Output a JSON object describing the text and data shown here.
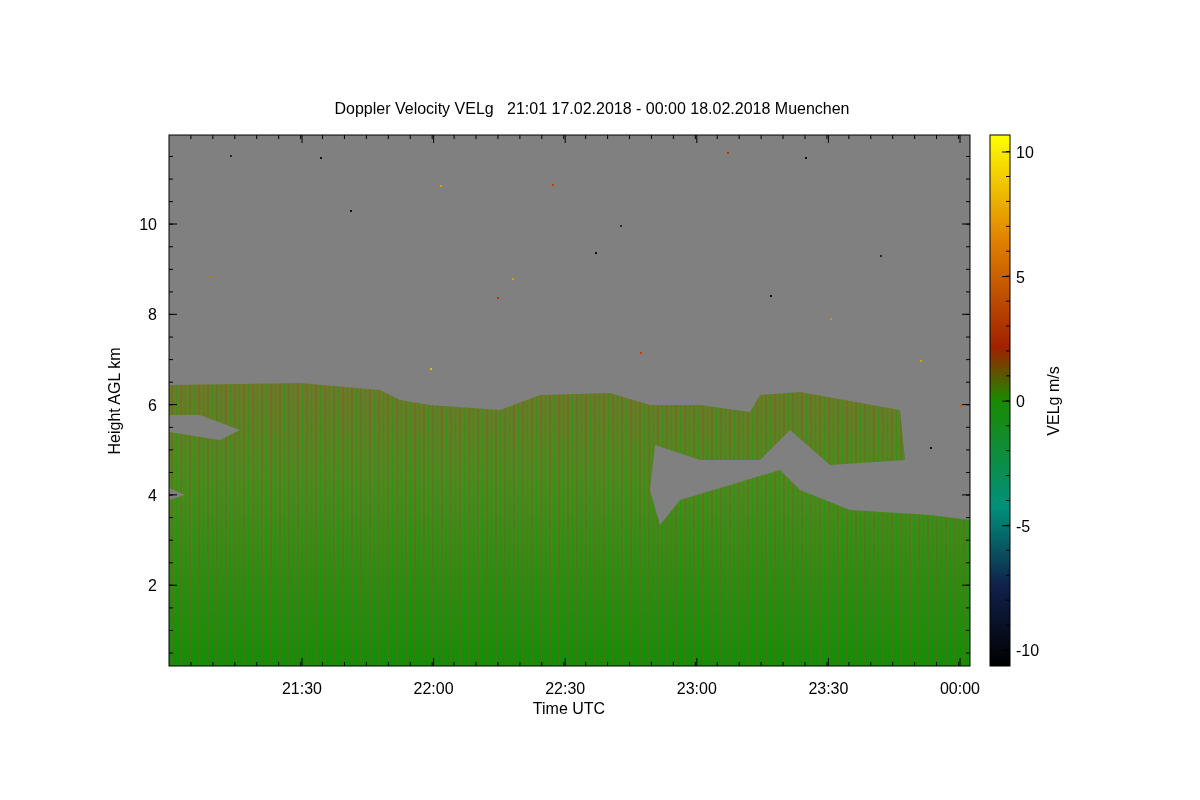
{
  "title": "Doppler Velocity VELg   21:01 17.02.2018 - 00:00 18.02.2018 Muenchen",
  "y_axis": {
    "label": "Height AGL km",
    "ticks": [
      "10",
      "8",
      "6",
      "4",
      "2"
    ]
  },
  "x_axis": {
    "label": "Time UTC",
    "ticks": [
      "21:30",
      "22:00",
      "22:30",
      "23:00",
      "23:30",
      "00:00"
    ]
  },
  "colorbar": {
    "label": "VELg m/s",
    "ticks": [
      "10",
      "5",
      "0",
      "-5",
      "-10"
    ]
  }
}
